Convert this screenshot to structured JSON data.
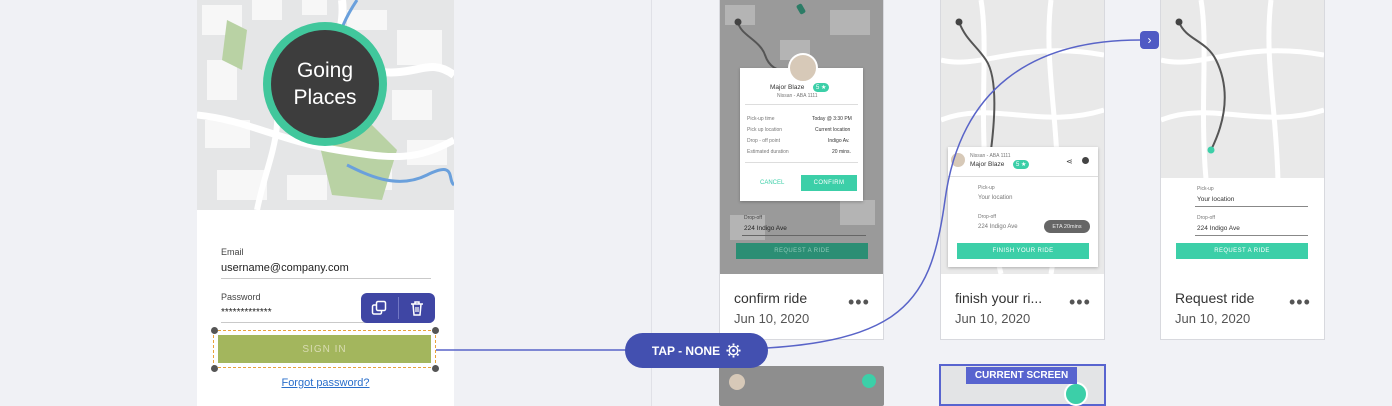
{
  "login": {
    "logo_line1": "Going",
    "logo_line2": "Places",
    "email_label": "Email",
    "email_value": "username@company.com",
    "password_label": "Password",
    "password_value": "*************",
    "sign_in_label": "SIGN IN",
    "forgot_label": "Forgot password?",
    "icons": {
      "duplicate": "duplicate-icon",
      "delete": "trash-icon"
    }
  },
  "connector": {
    "label": "TAP - NONE",
    "icon": "gear-icon",
    "arrow": "›",
    "color": "#4350b0"
  },
  "cards": [
    {
      "title": "confirm ride",
      "date": "Jun 10, 2020",
      "more": "•••",
      "driver_name": "Major Blaze",
      "rating": "5 ★",
      "vehicle": "Nissan - ABA 1111",
      "rows": [
        {
          "label": "Pick-up time",
          "value": "Today @ 3:30 PM"
        },
        {
          "label": "Pick up location",
          "value": "Current location"
        },
        {
          "label": "Drop - off point",
          "value": "Indigo Av."
        },
        {
          "label": "Estimated duration",
          "value": "20 mins."
        }
      ],
      "cancel": "CANCEL",
      "confirm": "CONFIRM",
      "dropoff_label": "Drop-off",
      "dropoff_value": "224 Indigo Ave",
      "request": "REQUEST A RIDE"
    },
    {
      "title": "finish your ri...",
      "date": "Jun 10, 2020",
      "more": "•••",
      "vehicle": "Nissan - ABA 1111",
      "driver_name": "Major Blaze",
      "rating": "5 ★",
      "pickup_label": "Pick-up",
      "pickup_value": "Your location",
      "dropoff_label": "Drop-off",
      "dropoff_value": "224 Indigo Ave",
      "eta": "ETA 20mins",
      "finish": "FINISH YOUR RIDE"
    },
    {
      "title": "Request ride",
      "date": "Jun 10, 2020",
      "more": "•••",
      "pickup_label": "Pick-up",
      "pickup_value": "Your location",
      "dropoff_label": "Drop-off",
      "dropoff_value": "224 Indigo Ave",
      "request": "REQUEST A RIDE"
    }
  ],
  "current_screen_label": "CURRENT SCREEN",
  "colors": {
    "teal": "#3ccfa8",
    "accent": "#4350b0",
    "logo_ring": "#41c79c"
  }
}
